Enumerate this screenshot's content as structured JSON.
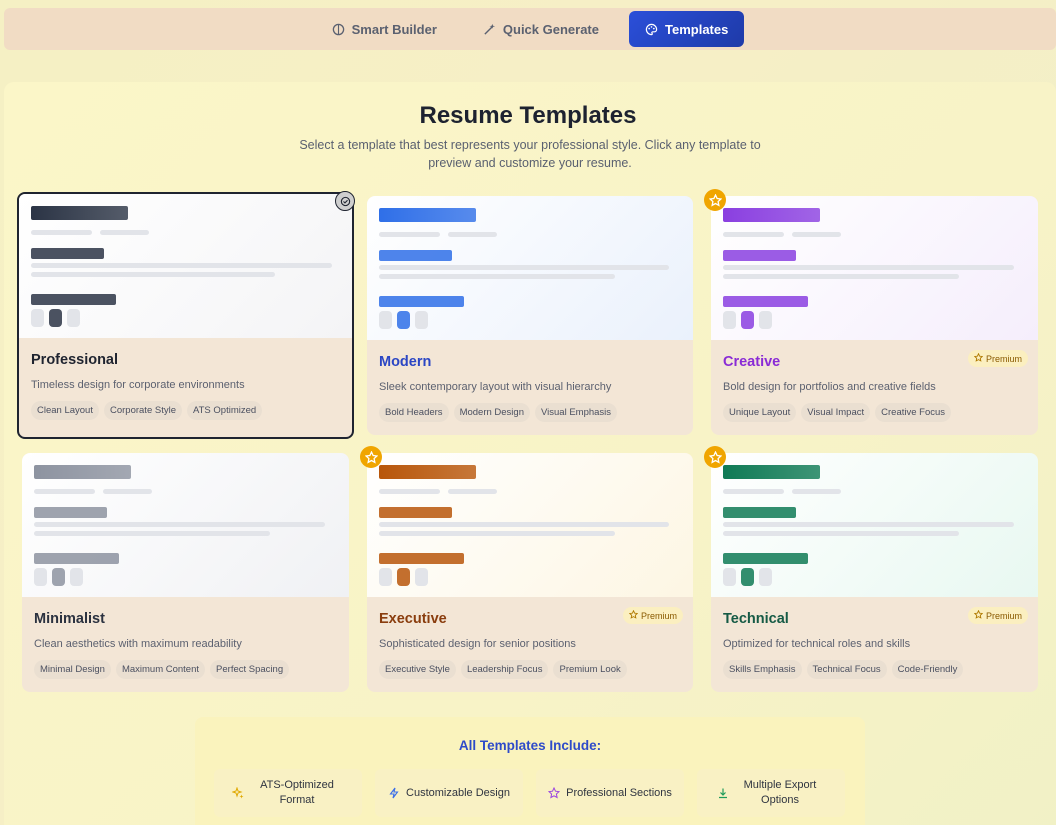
{
  "tabs": [
    {
      "label": "Smart Builder",
      "icon": "brain-icon",
      "active": false
    },
    {
      "label": "Quick Generate",
      "icon": "wand-icon",
      "active": false
    },
    {
      "label": "Templates",
      "icon": "palette-icon",
      "active": true
    }
  ],
  "header": {
    "title": "Resume Templates",
    "subtitle": "Select a template that best represents your professional style. Click any template to preview and customize your resume."
  },
  "premium_label": "Premium",
  "templates": [
    {
      "name": "Professional",
      "description": "Timeless design for corporate environments",
      "tags": [
        "Clean Layout",
        "Corporate Style",
        "ATS Optimized"
      ],
      "premium": false,
      "selected": true,
      "accent": "#2b3445",
      "name_color": "#1f2430"
    },
    {
      "name": "Modern",
      "description": "Sleek contemporary layout with visual hierarchy",
      "tags": [
        "Bold Headers",
        "Modern Design",
        "Visual Emphasis"
      ],
      "premium": false,
      "selected": false,
      "accent": "#2f6fe8",
      "name_color": "#2b46c4"
    },
    {
      "name": "Creative",
      "description": "Bold design for portfolios and creative fields",
      "tags": [
        "Unique Layout",
        "Visual Impact",
        "Creative Focus"
      ],
      "premium": true,
      "selected": false,
      "accent": "#8a3fe0",
      "name_color": "#8a2bd6"
    },
    {
      "name": "Minimalist",
      "description": "Clean aesthetics with maximum readability",
      "tags": [
        "Minimal Design",
        "Maximum Content",
        "Perfect Spacing"
      ],
      "premium": false,
      "selected": false,
      "accent": "#8d93a0",
      "name_color": "#2b3240"
    },
    {
      "name": "Executive",
      "description": "Sophisticated design for senior positions",
      "tags": [
        "Executive Style",
        "Leadership Focus",
        "Premium Look"
      ],
      "premium": true,
      "selected": false,
      "accent": "#b8560a",
      "name_color": "#8a3d0e"
    },
    {
      "name": "Technical",
      "description": "Optimized for technical roles and skills",
      "tags": [
        "Skills Emphasis",
        "Technical Focus",
        "Code-Friendly"
      ],
      "premium": true,
      "selected": false,
      "accent": "#0f7a55",
      "name_color": "#155a45"
    }
  ],
  "includes": {
    "title": "All Templates Include:",
    "features": [
      {
        "label": "ATS-Optimized Format",
        "icon": "sparkles-icon",
        "color": "#e0a800"
      },
      {
        "label": "Customizable Design",
        "icon": "lightning-icon",
        "color": "#3b6ee8"
      },
      {
        "label": "Professional Sections",
        "icon": "star-icon",
        "color": "#9b45e0"
      },
      {
        "label": "Multiple Export Options",
        "icon": "download-icon",
        "color": "#1f9b5a"
      }
    ]
  }
}
